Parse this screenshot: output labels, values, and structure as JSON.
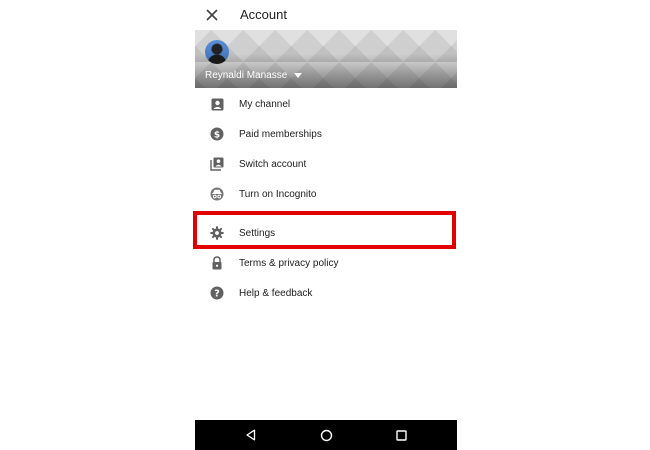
{
  "appbar": {
    "title": "Account",
    "close_icon": "close-icon"
  },
  "account": {
    "name": "Reynaldi Manasse",
    "dropdown_icon": "arrow-drop-down-icon"
  },
  "menu": {
    "items": [
      {
        "label": "My channel",
        "icon": "person-box-icon"
      },
      {
        "label": "Paid memberships",
        "icon": "dollar-circle-icon"
      },
      {
        "label": "Switch account",
        "icon": "switch-account-icon"
      },
      {
        "label": "Turn on Incognito",
        "icon": "incognito-icon"
      },
      {
        "label": "Settings",
        "icon": "gear-icon"
      },
      {
        "label": "Terms & privacy policy",
        "icon": "lock-icon"
      },
      {
        "label": "Help & feedback",
        "icon": "help-circle-icon"
      }
    ]
  },
  "navbar": {
    "back_icon": "back-triangle-icon",
    "home_icon": "home-circle-icon",
    "recents_icon": "recents-square-icon"
  },
  "colors": {
    "highlight": "#e00000",
    "icon_gray": "#616161",
    "text": "#212121",
    "navbar": "#000000"
  }
}
